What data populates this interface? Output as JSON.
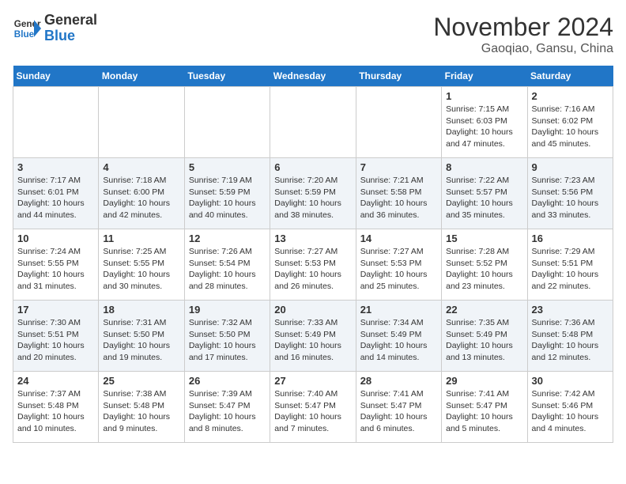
{
  "header": {
    "logo_line1": "General",
    "logo_line2": "Blue",
    "title": "November 2024",
    "subtitle": "Gaoqiao, Gansu, China"
  },
  "calendar": {
    "weekdays": [
      "Sunday",
      "Monday",
      "Tuesday",
      "Wednesday",
      "Thursday",
      "Friday",
      "Saturday"
    ],
    "weeks": [
      [
        {
          "day": "",
          "info": ""
        },
        {
          "day": "",
          "info": ""
        },
        {
          "day": "",
          "info": ""
        },
        {
          "day": "",
          "info": ""
        },
        {
          "day": "",
          "info": ""
        },
        {
          "day": "1",
          "info": "Sunrise: 7:15 AM\nSunset: 6:03 PM\nDaylight: 10 hours and 47 minutes."
        },
        {
          "day": "2",
          "info": "Sunrise: 7:16 AM\nSunset: 6:02 PM\nDaylight: 10 hours and 45 minutes."
        }
      ],
      [
        {
          "day": "3",
          "info": "Sunrise: 7:17 AM\nSunset: 6:01 PM\nDaylight: 10 hours and 44 minutes."
        },
        {
          "day": "4",
          "info": "Sunrise: 7:18 AM\nSunset: 6:00 PM\nDaylight: 10 hours and 42 minutes."
        },
        {
          "day": "5",
          "info": "Sunrise: 7:19 AM\nSunset: 5:59 PM\nDaylight: 10 hours and 40 minutes."
        },
        {
          "day": "6",
          "info": "Sunrise: 7:20 AM\nSunset: 5:59 PM\nDaylight: 10 hours and 38 minutes."
        },
        {
          "day": "7",
          "info": "Sunrise: 7:21 AM\nSunset: 5:58 PM\nDaylight: 10 hours and 36 minutes."
        },
        {
          "day": "8",
          "info": "Sunrise: 7:22 AM\nSunset: 5:57 PM\nDaylight: 10 hours and 35 minutes."
        },
        {
          "day": "9",
          "info": "Sunrise: 7:23 AM\nSunset: 5:56 PM\nDaylight: 10 hours and 33 minutes."
        }
      ],
      [
        {
          "day": "10",
          "info": "Sunrise: 7:24 AM\nSunset: 5:55 PM\nDaylight: 10 hours and 31 minutes."
        },
        {
          "day": "11",
          "info": "Sunrise: 7:25 AM\nSunset: 5:55 PM\nDaylight: 10 hours and 30 minutes."
        },
        {
          "day": "12",
          "info": "Sunrise: 7:26 AM\nSunset: 5:54 PM\nDaylight: 10 hours and 28 minutes."
        },
        {
          "day": "13",
          "info": "Sunrise: 7:27 AM\nSunset: 5:53 PM\nDaylight: 10 hours and 26 minutes."
        },
        {
          "day": "14",
          "info": "Sunrise: 7:27 AM\nSunset: 5:53 PM\nDaylight: 10 hours and 25 minutes."
        },
        {
          "day": "15",
          "info": "Sunrise: 7:28 AM\nSunset: 5:52 PM\nDaylight: 10 hours and 23 minutes."
        },
        {
          "day": "16",
          "info": "Sunrise: 7:29 AM\nSunset: 5:51 PM\nDaylight: 10 hours and 22 minutes."
        }
      ],
      [
        {
          "day": "17",
          "info": "Sunrise: 7:30 AM\nSunset: 5:51 PM\nDaylight: 10 hours and 20 minutes."
        },
        {
          "day": "18",
          "info": "Sunrise: 7:31 AM\nSunset: 5:50 PM\nDaylight: 10 hours and 19 minutes."
        },
        {
          "day": "19",
          "info": "Sunrise: 7:32 AM\nSunset: 5:50 PM\nDaylight: 10 hours and 17 minutes."
        },
        {
          "day": "20",
          "info": "Sunrise: 7:33 AM\nSunset: 5:49 PM\nDaylight: 10 hours and 16 minutes."
        },
        {
          "day": "21",
          "info": "Sunrise: 7:34 AM\nSunset: 5:49 PM\nDaylight: 10 hours and 14 minutes."
        },
        {
          "day": "22",
          "info": "Sunrise: 7:35 AM\nSunset: 5:49 PM\nDaylight: 10 hours and 13 minutes."
        },
        {
          "day": "23",
          "info": "Sunrise: 7:36 AM\nSunset: 5:48 PM\nDaylight: 10 hours and 12 minutes."
        }
      ],
      [
        {
          "day": "24",
          "info": "Sunrise: 7:37 AM\nSunset: 5:48 PM\nDaylight: 10 hours and 10 minutes."
        },
        {
          "day": "25",
          "info": "Sunrise: 7:38 AM\nSunset: 5:48 PM\nDaylight: 10 hours and 9 minutes."
        },
        {
          "day": "26",
          "info": "Sunrise: 7:39 AM\nSunset: 5:47 PM\nDaylight: 10 hours and 8 minutes."
        },
        {
          "day": "27",
          "info": "Sunrise: 7:40 AM\nSunset: 5:47 PM\nDaylight: 10 hours and 7 minutes."
        },
        {
          "day": "28",
          "info": "Sunrise: 7:41 AM\nSunset: 5:47 PM\nDaylight: 10 hours and 6 minutes."
        },
        {
          "day": "29",
          "info": "Sunrise: 7:41 AM\nSunset: 5:47 PM\nDaylight: 10 hours and 5 minutes."
        },
        {
          "day": "30",
          "info": "Sunrise: 7:42 AM\nSunset: 5:46 PM\nDaylight: 10 hours and 4 minutes."
        }
      ]
    ]
  }
}
